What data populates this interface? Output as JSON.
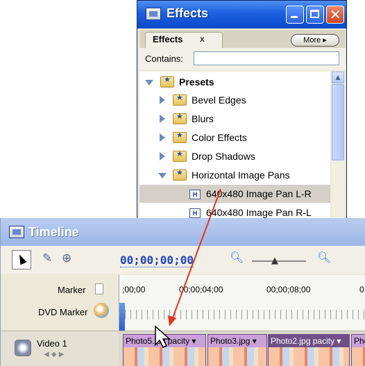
{
  "effects_window": {
    "title": "Effects",
    "tab_label": "Effects",
    "tab_close": "x",
    "more_button": "More ▸",
    "contains_label": "Contains:",
    "contains_value": "",
    "tree": [
      {
        "label": "Presets",
        "expanded": true,
        "icon": "preset-folder-icon"
      },
      {
        "label": "Bevel Edges",
        "expanded": false,
        "icon": "preset-folder-icon"
      },
      {
        "label": "Blurs",
        "expanded": false,
        "icon": "preset-folder-icon"
      },
      {
        "label": "Color Effects",
        "expanded": false,
        "icon": "preset-folder-icon"
      },
      {
        "label": "Drop Shadows",
        "expanded": false,
        "icon": "preset-folder-icon"
      },
      {
        "label": "Horizontal Image Pans",
        "expanded": true,
        "icon": "preset-folder-icon"
      },
      {
        "label": "640x480 Image Pan L-R",
        "selected": true,
        "icon": "effect-preset-icon"
      },
      {
        "label": "640x480 Image Pan R-L",
        "selected": false,
        "icon": "effect-preset-icon"
      }
    ]
  },
  "timeline_window": {
    "title": "Timeline",
    "timecode": "00;00;00;00",
    "marker_label": "Marker",
    "dvd_marker_label": "DVD Marker",
    "ruler_ticks": [
      ";00;00",
      "00;00;04;00",
      "00;00;08;00",
      "0"
    ],
    "track_name": "Video 1",
    "keyframe_nav": "◀ ◆ ▶",
    "clips": [
      {
        "label": "Photo5.jpg",
        "extra": "pacity ▾"
      },
      {
        "label": "Photo3.jpg",
        "extra": "▾"
      },
      {
        "label": "Photo2.jpg",
        "extra": "pacity ▾"
      },
      {
        "label": "Pho",
        "extra": ""
      }
    ]
  },
  "colors": {
    "xp_title_blue": "#1c5ee0",
    "timecode_blue": "#2144c8",
    "drag_arrow_red": "#e8331c",
    "clip_purple": "#6f4f86"
  }
}
